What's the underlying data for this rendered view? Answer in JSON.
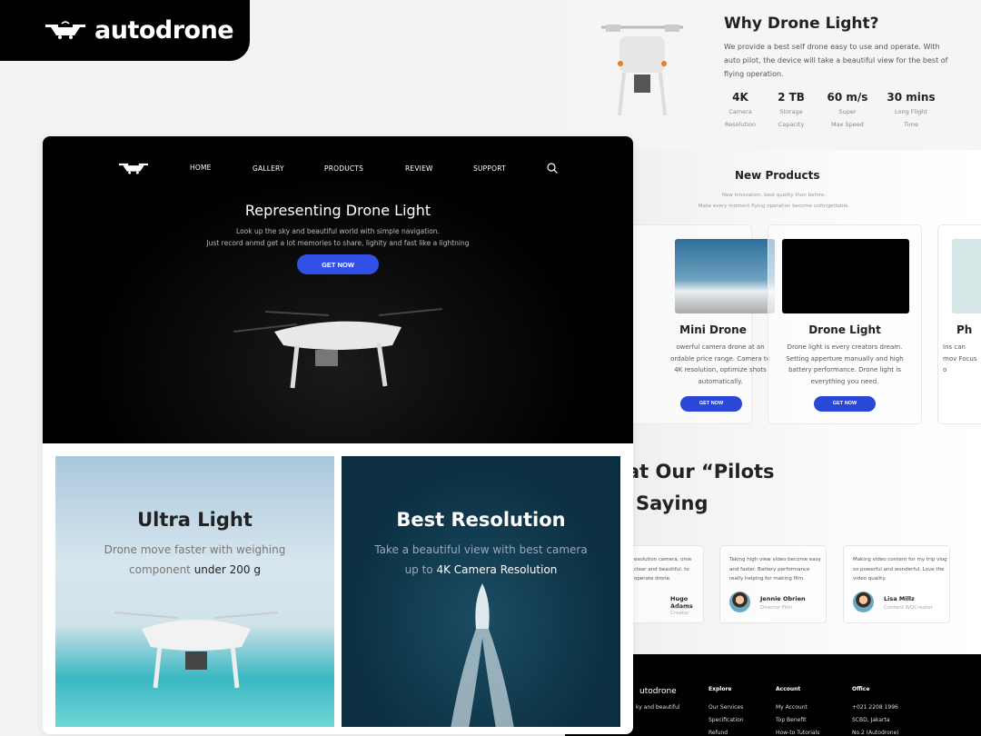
{
  "brand": {
    "name": "autodrone",
    "icon": "drone-icon"
  },
  "why": {
    "title": "Why Drone Light?",
    "text": "We provide a best self drone easy to use and operate. With auto pilot, the device will take a beautiful view for the best of flying operation.",
    "stats": [
      {
        "value": "4K",
        "l1": "Camera",
        "l2": "Resolution"
      },
      {
        "value": "2 TB",
        "l1": "Storage",
        "l2": "Capacity"
      },
      {
        "value": "60 m/s",
        "l1": "Super",
        "l2": "Max Speed"
      },
      {
        "value": "30 mins",
        "l1": "Long Flight",
        "l2": "Time"
      }
    ]
  },
  "products": {
    "title": "New Products",
    "sub1": "New innovation, best quality than before.",
    "sub2": "Make every moment flying operation become unforgettable.",
    "items": [
      {
        "name": "Mini Drone",
        "desc": "owerful camera drone at an ordable price range. Camera to 4K resolution, optimize shots automatically.",
        "button": "GET NOW"
      },
      {
        "name": "Drone Light",
        "desc": "Drone light is every creators dream. Setting apperture manually and high battery  performance. Drone light is everything you need.",
        "button": "GET NOW"
      },
      {
        "name": "Ph",
        "desc": "Ins can mov Focus o"
      }
    ]
  },
  "testimonials": {
    "heading1": "at Our “Pilots",
    "heading2": "Saying",
    "items": [
      {
        "quote": "esolution camera, ome clear and beautiful. to operate drone.",
        "name": "Hugo Adams",
        "role": "Content Creator"
      },
      {
        "quote": "Taking high view video become easy and faster. Battery performance really helping for making film.",
        "name": "Jennie Obrien",
        "role": "Director Film"
      },
      {
        "quote": "Making video content for my trip vlog so powerful and wonderful. Love the video quality.",
        "name": "Lisa Millz",
        "role": "Content WQCreator"
      }
    ]
  },
  "footer": {
    "brand": "utodrone",
    "tagline": "ky and beautiful",
    "cols": [
      {
        "title": "Explore",
        "links": [
          "Our Services",
          "Specification",
          "Refund"
        ]
      },
      {
        "title": "Account",
        "links": [
          "My Account",
          "Top Benefit",
          "How-to Tutorials"
        ]
      },
      {
        "title": "Office",
        "links": [
          "+021 2208 1996",
          "SCBD, Jakarta",
          "No.2 (Autodrone)"
        ]
      }
    ]
  },
  "hero": {
    "nav": [
      "HOME",
      "GALLERY",
      "PRODUCTS",
      "REVIEW",
      "SUPPORT"
    ],
    "search_icon": "search-icon",
    "title": "Representing Drone Light",
    "sub1": "Look up the  sky and beautiful world with simple navigation.",
    "sub2": "Just record anmd get a lot memories to share, lighity and fast like a lightning",
    "button": "GET NOW",
    "accent": "#3050e8"
  },
  "tiles": [
    {
      "title": "Ultra Light",
      "line1": "Drone move faster with weighing",
      "line2a": "component ",
      "line2b": "under 200 g"
    },
    {
      "title": "Best Resolution",
      "line1": "Take a beautiful view with best camera",
      "line2a": "up to ",
      "line2b": "4K Camera Resolution"
    }
  ]
}
